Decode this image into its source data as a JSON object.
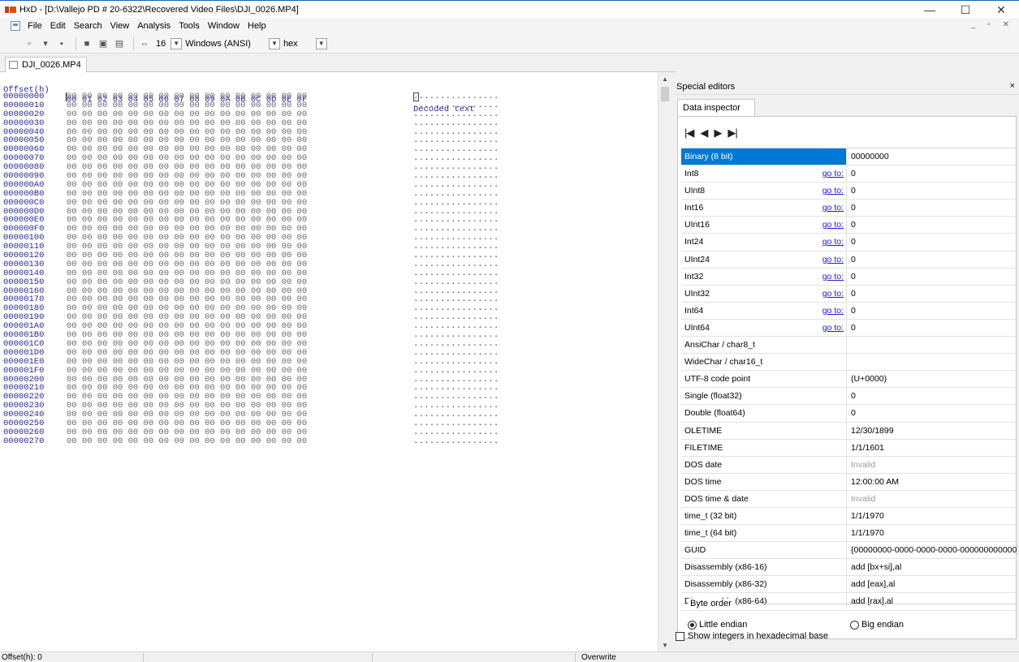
{
  "window": {
    "title": "HxD - [D:\\Vallejo PD # 20-6322\\Recovered Video Files\\DJI_0026.MP4]",
    "minimize": "—",
    "maximize": "☐",
    "close": "✕"
  },
  "menu": {
    "items": [
      "File",
      "Edit",
      "Search",
      "View",
      "Analysis",
      "Tools",
      "Window",
      "Help"
    ],
    "mdi": "_ ▫ ✕"
  },
  "toolbar": {
    "bytes_per_row": "16",
    "charset": "Windows (ANSI)",
    "display": "hex"
  },
  "document_tab": "DJI_0026.MP4",
  "hex": {
    "offset_header": "Offset(h)",
    "columns_header": "00 01 02 03 04 05 06 07 08 09 0A 0B 0C 0D 0E 0F",
    "decoded_header": "Decoded text",
    "row_bytes": "00 00 00 00 00 00 00 00 00 00 00 00 00 00 00 00",
    "row_text": "................",
    "offsets": [
      "00000000",
      "00000010",
      "00000020",
      "00000030",
      "00000040",
      "00000050",
      "00000060",
      "00000070",
      "00000080",
      "00000090",
      "000000A0",
      "000000B0",
      "000000C0",
      "000000D0",
      "000000E0",
      "000000F0",
      "00000100",
      "00000110",
      "00000120",
      "00000130",
      "00000140",
      "00000150",
      "00000160",
      "00000170",
      "00000180",
      "00000190",
      "000001A0",
      "000001B0",
      "000001C0",
      "000001D0",
      "000001E0",
      "000001F0",
      "00000200",
      "00000210",
      "00000220",
      "00000230",
      "00000240",
      "00000250",
      "00000260",
      "00000270"
    ]
  },
  "special_editors": {
    "title": "Special editors",
    "close": "×",
    "tab": "Data inspector",
    "nav": [
      "first-icon",
      "prev-icon",
      "next-icon",
      "last-icon"
    ],
    "goto_label": "go to:",
    "rows": [
      {
        "name": "Binary (8 bit)",
        "value": "00000000",
        "goto": false
      },
      {
        "name": "Int8",
        "value": "0",
        "goto": true
      },
      {
        "name": "UInt8",
        "value": "0",
        "goto": true
      },
      {
        "name": "Int16",
        "value": "0",
        "goto": true
      },
      {
        "name": "UInt16",
        "value": "0",
        "goto": true
      },
      {
        "name": "Int24",
        "value": "0",
        "goto": true
      },
      {
        "name": "UInt24",
        "value": "0",
        "goto": true
      },
      {
        "name": "Int32",
        "value": "0",
        "goto": true
      },
      {
        "name": "UInt32",
        "value": "0",
        "goto": true
      },
      {
        "name": "Int64",
        "value": "0",
        "goto": true
      },
      {
        "name": "UInt64",
        "value": "0",
        "goto": true
      },
      {
        "name": "AnsiChar / char8_t",
        "value": "",
        "goto": false
      },
      {
        "name": "WideChar / char16_t",
        "value": "",
        "goto": false
      },
      {
        "name": "UTF-8 code point",
        "value": "   (U+0000)",
        "goto": false
      },
      {
        "name": "Single (float32)",
        "value": "0",
        "goto": false
      },
      {
        "name": "Double (float64)",
        "value": "0",
        "goto": false
      },
      {
        "name": "OLETIME",
        "value": "12/30/1899",
        "goto": false
      },
      {
        "name": "FILETIME",
        "value": "1/1/1601",
        "goto": false
      },
      {
        "name": "DOS date",
        "value": "Invalid",
        "goto": false,
        "gray": true
      },
      {
        "name": "DOS time",
        "value": "12:00:00 AM",
        "goto": false
      },
      {
        "name": "DOS time & date",
        "value": "Invalid",
        "goto": false,
        "gray": true
      },
      {
        "name": "time_t (32 bit)",
        "value": "1/1/1970",
        "goto": false
      },
      {
        "name": "time_t (64 bit)",
        "value": "1/1/1970",
        "goto": false
      },
      {
        "name": "GUID",
        "value": "{00000000-0000-0000-0000-000000000000}",
        "goto": false
      },
      {
        "name": "Disassembly (x86-16)",
        "value": "add [bx+si],al",
        "goto": false
      },
      {
        "name": "Disassembly (x86-32)",
        "value": "add [eax],al",
        "goto": false
      },
      {
        "name": "Disassembly (x86-64)",
        "value": "add [rax],al",
        "goto": false
      }
    ],
    "byte_order": {
      "title": "Byte order",
      "little": "Little endian",
      "big": "Big endian",
      "selected": "little"
    },
    "show_hex": "Show integers in hexadecimal base"
  },
  "status": {
    "offset": "Offset(h): 0",
    "mode": "Overwrite"
  }
}
